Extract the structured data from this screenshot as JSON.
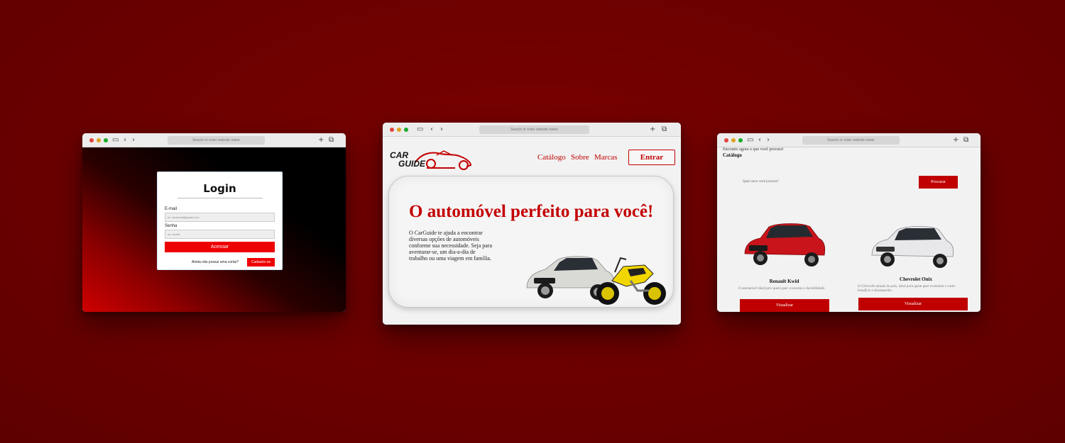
{
  "browser": {
    "url_placeholder": "Search or enter website name"
  },
  "login": {
    "title": "Login",
    "email_label": "E-mail",
    "email_placeholder": "ex: seuemail@gmail.com",
    "password_label": "Senha",
    "password_placeholder": "ex: senha",
    "submit_label": "Acessar",
    "no_account_text": "Ainda não possui uma conta?",
    "signup_label": "Cadastre-se"
  },
  "home": {
    "logo_line1": "CAR",
    "logo_line2": "GUIDE",
    "nav": [
      "Catálogo",
      "Sobre",
      "Marcas"
    ],
    "login_button": "Entrar",
    "hero_title": "O automóvel perfeito para você!",
    "hero_description": "O CarGuide te ajuda a encontrar diversas opções de automóveis conforme sua necessidade. Seja para aventurar-se, um dia-a-dia de trabalho ou uma viagem em família."
  },
  "catalog": {
    "caption": "Encontre agora o que você procura!",
    "title": "Catálogo",
    "search_placeholder": "Qual carro você procura?",
    "search_button": "Procurar",
    "cars": [
      {
        "name": "Renault Kwid",
        "description": "O automóvel ideal para quem quer economia e durabilidade.",
        "button": "Visualizar",
        "color": "#c8141a"
      },
      {
        "name": "Chevrolet Onix",
        "description": "O Chevrolet amado do país, ideal para quem quer economia e custo-benefício e desempenho.",
        "button": "Visualizar",
        "color": "#e8e8ea"
      }
    ]
  },
  "colors": {
    "background": "#6a0000",
    "accent": "#c00000",
    "bright_red": "#ee0000"
  }
}
